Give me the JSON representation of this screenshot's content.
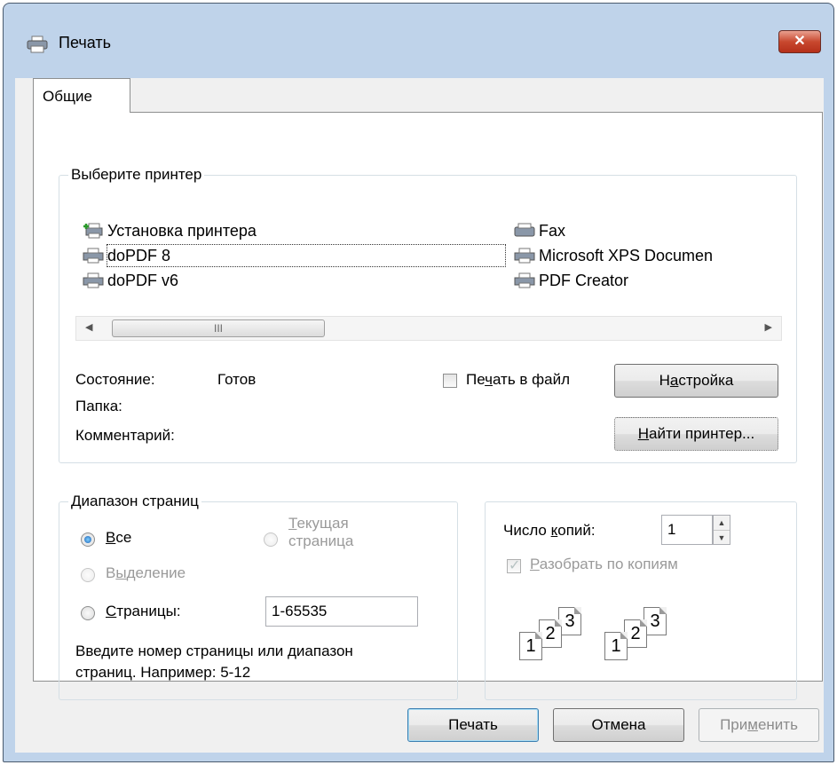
{
  "window": {
    "title": "Печать",
    "close_label": "✕"
  },
  "tabs": [
    {
      "label": "Общие"
    }
  ],
  "printer_group": {
    "label": "Выберите принтер",
    "printers": [
      {
        "name": "Установка принтера",
        "icon": "add-printer-icon"
      },
      {
        "name": "doPDF 8",
        "icon": "printer-icon",
        "selected": true
      },
      {
        "name": "doPDF v6",
        "icon": "printer-icon"
      },
      {
        "name": "Fax",
        "icon": "fax-icon"
      },
      {
        "name": "Microsoft XPS Documen",
        "icon": "printer-icon"
      },
      {
        "name": "PDF Creator",
        "icon": "printer-icon"
      }
    ],
    "scroll_thumb": "III",
    "status_label": "Состояние:",
    "status_value": "Готов",
    "folder_label": "Папка:",
    "comment_label": "Комментарий:",
    "print_to_file": {
      "pre": "Пе",
      "u": "ч",
      "post": "ать в файл",
      "checked": false
    },
    "settings_button": {
      "pre": "Н",
      "u": "а",
      "post": "стройка"
    },
    "find_button": {
      "pre": "",
      "u": "Н",
      "post": "айти принтер..."
    }
  },
  "range_group": {
    "label": "Диапазон страниц",
    "all": {
      "pre": "",
      "u": "В",
      "post": "се",
      "selected": true
    },
    "current_line1": {
      "pre": "",
      "u": "Т",
      "post": "екущая"
    },
    "current_line2": "страница",
    "selection": {
      "pre": "В",
      "u": "ы",
      "post": "деление"
    },
    "pages": {
      "pre": "",
      "u": "С",
      "post": "траницы:"
    },
    "pages_value": "1-65535",
    "hint_line1": "Введите номер страницы или диапазон",
    "hint_line2": "страниц.  Например: 5-12"
  },
  "copies_group": {
    "copies_label": {
      "pre": "Число ",
      "u": "к",
      "post": "опий:"
    },
    "copies_value": "1",
    "collate": {
      "pre": "",
      "u": "Р",
      "post": "азобрать по копиям",
      "checked": true
    },
    "collate_pages": [
      "1",
      "2",
      "3",
      "1",
      "2",
      "3"
    ]
  },
  "footer": {
    "print_button": "Печать",
    "cancel_button": "Отмена",
    "apply_button": {
      "pre": "При",
      "u": "м",
      "post": "енить"
    }
  }
}
